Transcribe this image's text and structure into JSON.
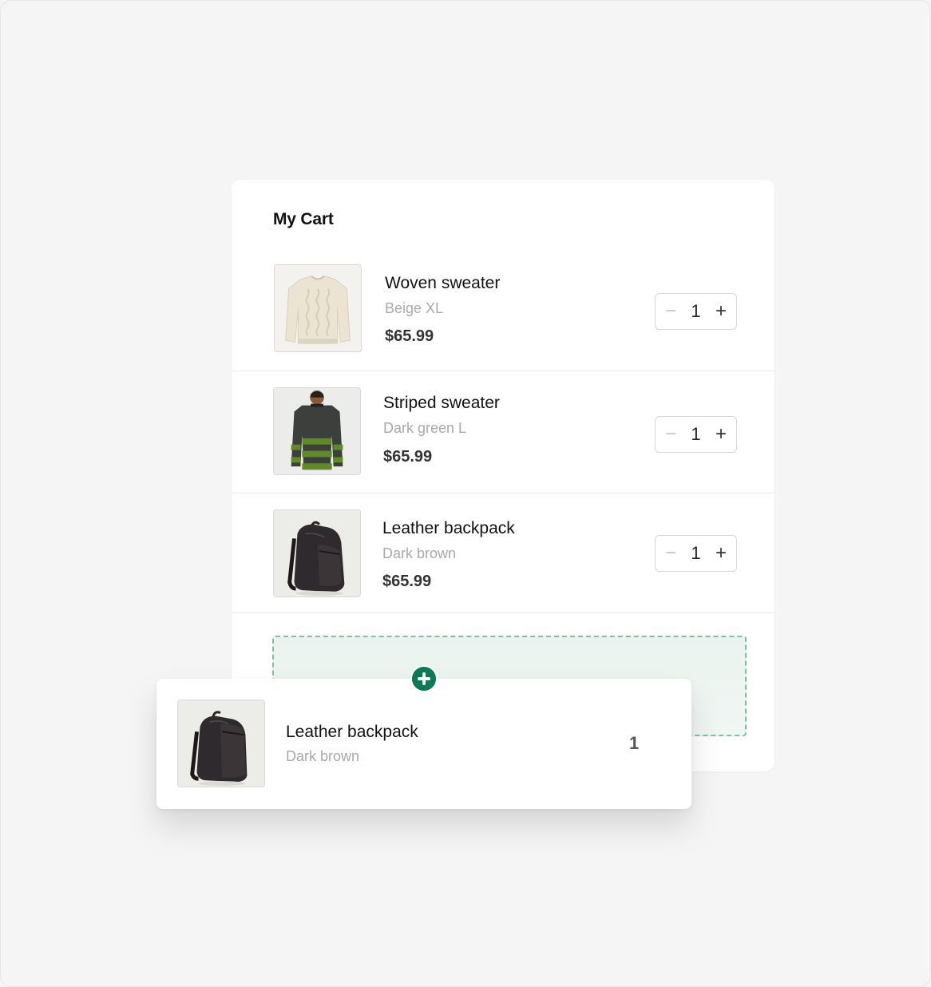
{
  "cart": {
    "title": "My Cart",
    "items": [
      {
        "name": "Woven sweater",
        "variant": "Beige XL",
        "price": "$65.99",
        "quantity": "1",
        "image": "beige-cable-knit-sweater"
      },
      {
        "name": "Striped sweater",
        "variant": "Dark green L",
        "price": "$65.99",
        "quantity": "1",
        "image": "man-striped-sweater"
      },
      {
        "name": "Leather backpack",
        "variant": "Dark brown",
        "price": "$65.99",
        "quantity": "1",
        "image": "leather-backpack"
      }
    ],
    "stepper": {
      "minus_icon": "minus-icon",
      "plus_icon": "plus-icon"
    }
  },
  "dropzone": {
    "icon": "add-circle-icon",
    "accent_color": "#0a7a55",
    "border_color": "#7fbfa0"
  },
  "dragged_item": {
    "name": "Leather backpack",
    "variant": "Dark brown",
    "quantity": "1",
    "image": "leather-backpack"
  }
}
